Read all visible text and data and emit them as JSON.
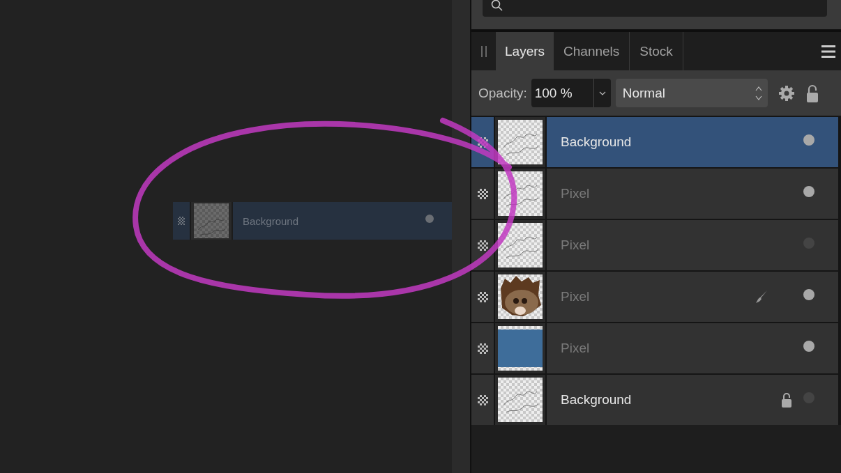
{
  "tabs": [
    {
      "label": "Layers",
      "selected": true
    },
    {
      "label": "Channels",
      "selected": false
    },
    {
      "label": "Stock",
      "selected": false
    }
  ],
  "opacity": {
    "label": "Opacity:",
    "value": "100 %"
  },
  "blend_mode": {
    "value": "Normal"
  },
  "layers": [
    {
      "name": "Background",
      "selected": true,
      "dimmed": false,
      "visible": true,
      "kind": "sketch",
      "painting": false,
      "locked": false
    },
    {
      "name": "Pixel",
      "selected": false,
      "dimmed": true,
      "visible": true,
      "kind": "sketch",
      "painting": false,
      "locked": false
    },
    {
      "name": "Pixel",
      "selected": false,
      "dimmed": true,
      "visible": false,
      "kind": "sketch",
      "painting": false,
      "locked": false
    },
    {
      "name": "Pixel",
      "selected": false,
      "dimmed": true,
      "visible": true,
      "kind": "creature",
      "painting": true,
      "locked": false
    },
    {
      "name": "Pixel",
      "selected": false,
      "dimmed": true,
      "visible": true,
      "kind": "fill",
      "painting": false,
      "locked": false
    },
    {
      "name": "Background",
      "selected": false,
      "dimmed": false,
      "visible": false,
      "kind": "sketch",
      "painting": false,
      "locked": true
    }
  ],
  "dragged_layer": {
    "name": "Background",
    "visible": true
  }
}
